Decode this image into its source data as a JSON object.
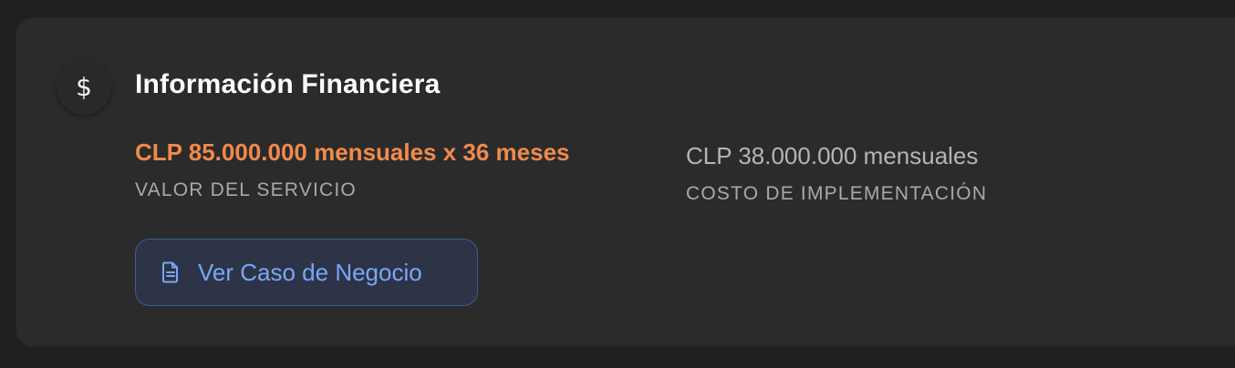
{
  "card": {
    "icon": "dollar-sign-icon",
    "icon_glyph": "$",
    "title": "Información Financiera"
  },
  "fields": [
    {
      "value": "CLP 85.000.000 mensuales x 36 meses",
      "label": "VALOR DEL SERVICIO",
      "value_color": "#f08a4b"
    },
    {
      "value": "CLP 38.000.000 mensuales",
      "label": "COSTO DE IMPLEMENTACIÓN",
      "value_color": "#b5b5b5"
    }
  ],
  "button": {
    "icon": "document-icon",
    "label": "Ver Caso de Negocio",
    "text_color": "#7aa7f5"
  },
  "colors": {
    "background": "#202020",
    "card": "#2b2b2b",
    "accent": "#f08a4b",
    "link": "#7aa7f5"
  }
}
